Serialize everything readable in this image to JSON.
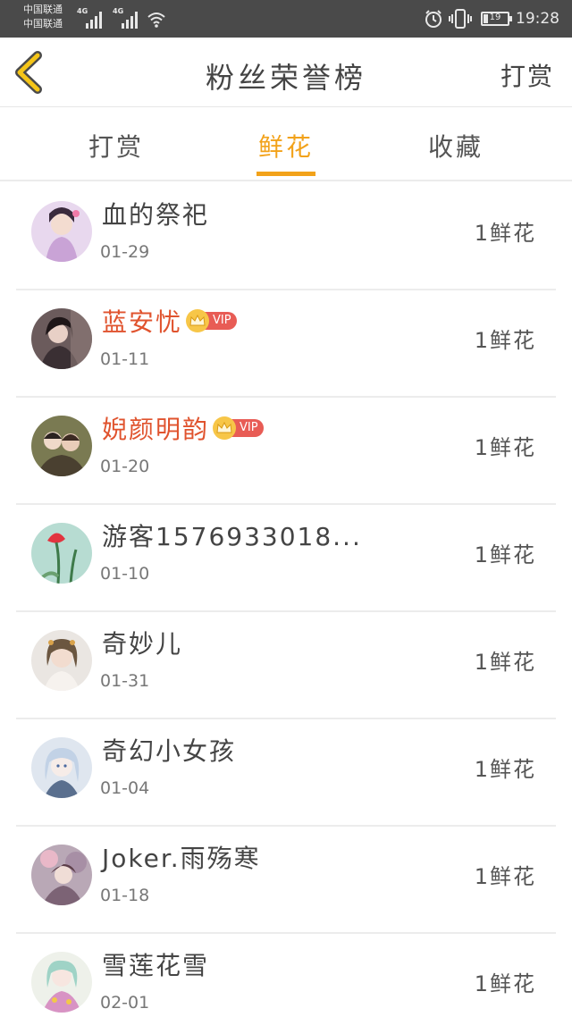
{
  "status_bar": {
    "carrier_1": "中国联通",
    "carrier_2": "中国联通",
    "network_1": "4G",
    "network_2": "4G",
    "battery": "19",
    "time": "19:28"
  },
  "header": {
    "title": "粉丝荣誉榜",
    "right_action": "打赏"
  },
  "tabs": [
    {
      "label": "打赏",
      "active": false
    },
    {
      "label": "鲜花",
      "active": true
    },
    {
      "label": "收藏",
      "active": false
    }
  ],
  "vip_label": "VIP",
  "fans": [
    {
      "name": "血的祭祀",
      "date": "01-29",
      "count": "1鲜花",
      "vip": false
    },
    {
      "name": "蓝安忧",
      "date": "01-11",
      "count": "1鲜花",
      "vip": true
    },
    {
      "name": "婗颜明韵",
      "date": "01-20",
      "count": "1鲜花",
      "vip": true
    },
    {
      "name": "游客1576933018...",
      "date": "01-10",
      "count": "1鲜花",
      "vip": false
    },
    {
      "name": "奇妙儿",
      "date": "01-31",
      "count": "1鲜花",
      "vip": false
    },
    {
      "name": "奇幻小女孩",
      "date": "01-04",
      "count": "1鲜花",
      "vip": false
    },
    {
      "name": "Joker.雨殇寒",
      "date": "01-18",
      "count": "1鲜花",
      "vip": false
    },
    {
      "name": "雪莲花雪",
      "date": "02-01",
      "count": "1鲜花",
      "vip": false
    }
  ],
  "colors": {
    "accent": "#f2a21a",
    "vip_name": "#e0532e",
    "status_bar": "#4a4a4a"
  }
}
